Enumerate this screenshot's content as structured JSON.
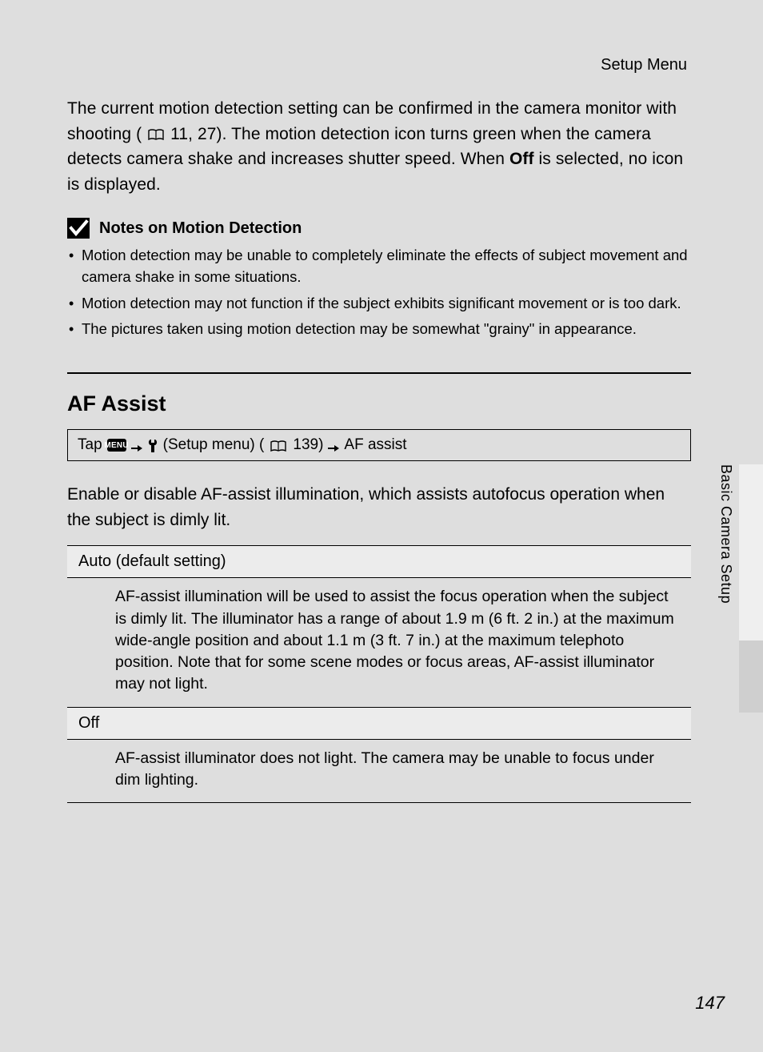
{
  "header": {
    "section": "Setup Menu"
  },
  "intro": {
    "p1a": "The current motion detection setting can be confirmed in the camera monitor with shooting (",
    "p1_ref": " 11, 27). The motion detection icon turns green when the camera detects camera shake and increases shutter speed. When ",
    "p1_strong": "Off",
    "p1_end": " is selected, no icon is displayed."
  },
  "notes": {
    "title": "Notes on Motion Detection",
    "items": [
      "Motion detection may be unable to completely eliminate the effects of subject movement and camera shake in some situations.",
      "Motion detection may not function if the subject exhibits significant movement or is too dark.",
      "The pictures taken using motion detection may be somewhat \"grainy\" in appearance."
    ]
  },
  "section": {
    "title": "AF Assist",
    "nav": {
      "tap": "Tap",
      "menu_chip": "MENU",
      "setup": "(Setup menu) (",
      "page_ref": " 139)",
      "end": "AF assist"
    },
    "body": "Enable or disable AF-assist illumination, which assists autofocus operation when the subject is dimly lit.",
    "options": [
      {
        "name": "Auto (default setting)",
        "desc": "AF-assist illumination will be used to assist the focus operation when the subject is dimly lit. The illuminator has a range of about 1.9 m (6 ft. 2 in.) at the maximum wide-angle position and about 1.1 m (3 ft. 7 in.) at the maximum telephoto position. Note that for some scene modes or focus areas, AF-assist illuminator may not light."
      },
      {
        "name": "Off",
        "desc": "AF-assist illuminator does not light. The camera may be unable to focus under dim lighting."
      }
    ]
  },
  "side": {
    "label": "Basic Camera Setup"
  },
  "page_number": "147"
}
